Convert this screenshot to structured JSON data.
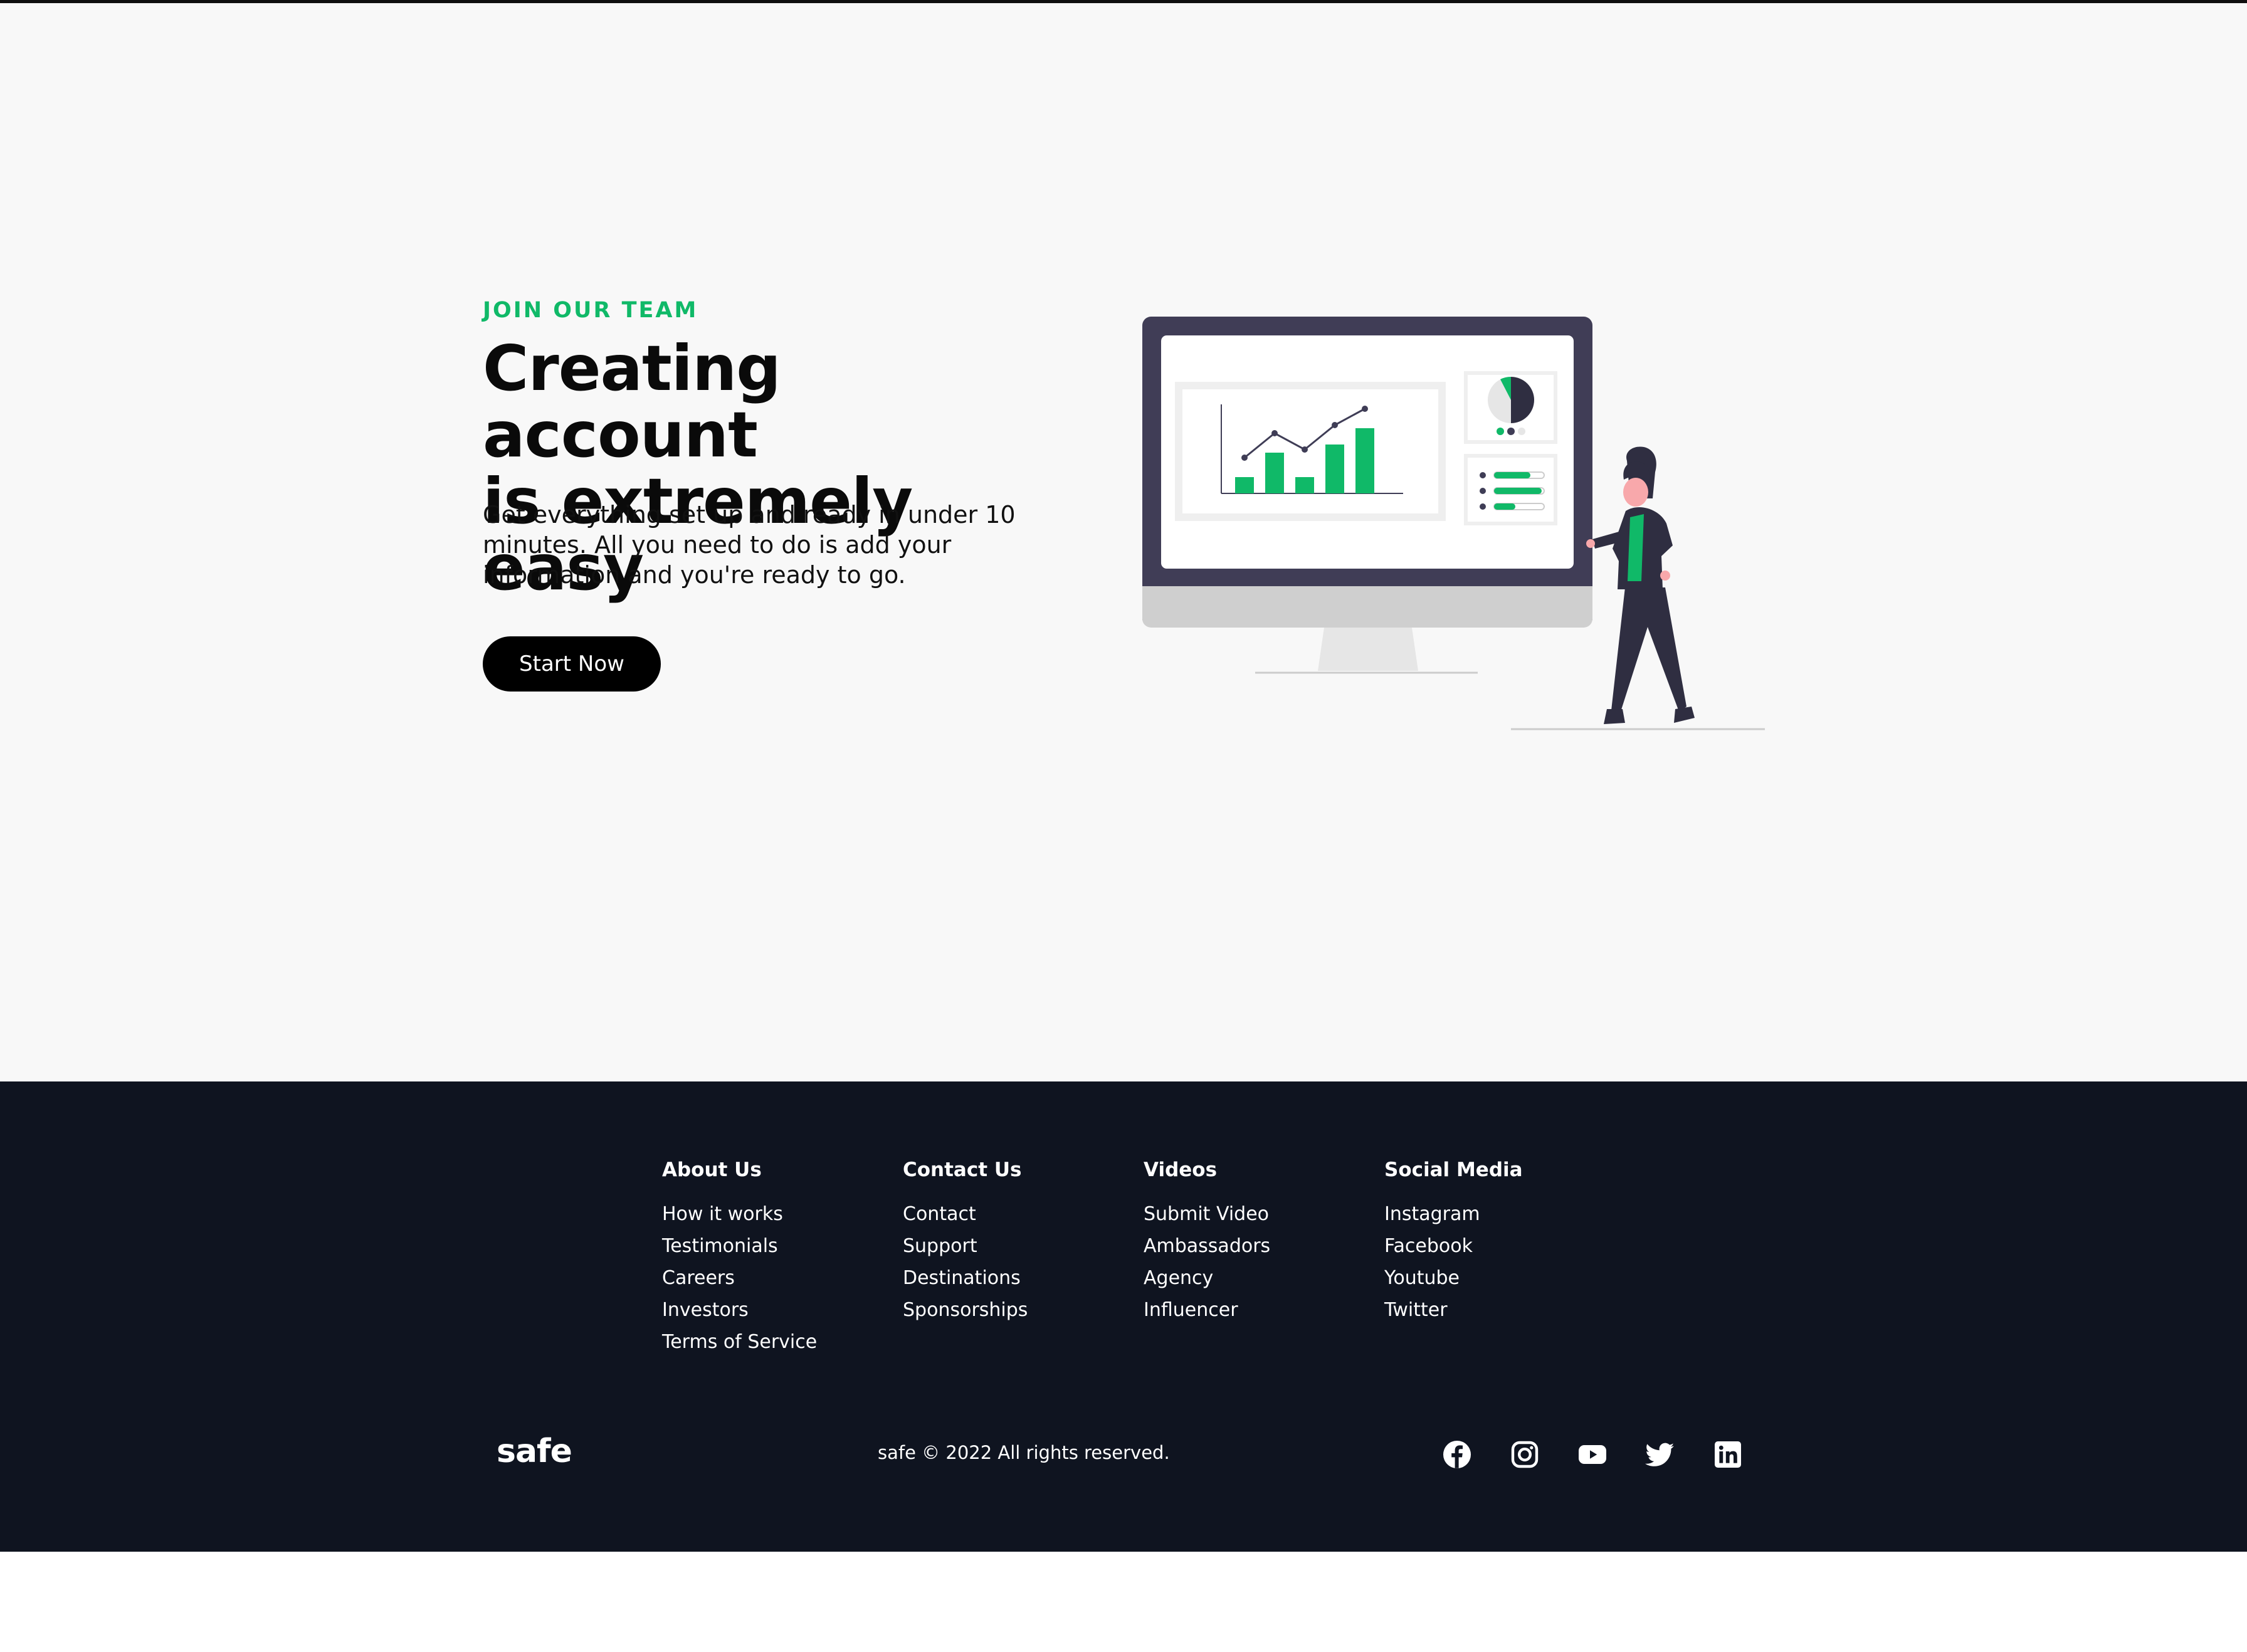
{
  "colors": {
    "accent": "#10b968",
    "hero_bg": "#f8f8f8",
    "footer_bg": "#0f1420",
    "button_bg": "#000000",
    "monitor_frame": "#403d56",
    "person_suit": "#2f2e41",
    "person_skin": "#f8a8ab"
  },
  "hero": {
    "eyebrow": "JOIN OUR TEAM",
    "headline_line1": "Creating account",
    "headline_line2": "is extremely easy",
    "description": "Get everything set up and ready in under 10 minutes. All you need to do is add your information and you're ready to go.",
    "cta_label": "Start Now"
  },
  "illustration": {
    "icon": "person-presenting-monitor-analytics-illustration",
    "bar_values": [
      2,
      5,
      2,
      6,
      8
    ],
    "line_values": [
      3,
      6,
      4,
      7,
      9
    ]
  },
  "footer": {
    "columns": [
      {
        "title": "About Us",
        "links": [
          "How it works",
          "Testimonials",
          "Careers",
          "Investors",
          "Terms of Service"
        ]
      },
      {
        "title": "Contact Us",
        "links": [
          "Contact",
          "Support",
          "Destinations",
          "Sponsorships"
        ]
      },
      {
        "title": "Videos",
        "links": [
          "Submit Video",
          "Ambassadors",
          "Agency",
          "Influencer"
        ]
      },
      {
        "title": "Social Media",
        "links": [
          "Instagram",
          "Facebook",
          "Youtube",
          "Twitter"
        ]
      }
    ],
    "logo": "safe",
    "copyright": "safe © 2022 All rights reserved.",
    "social_icons": [
      "facebook-icon",
      "instagram-icon",
      "youtube-icon",
      "twitter-icon",
      "linkedin-icon"
    ]
  }
}
